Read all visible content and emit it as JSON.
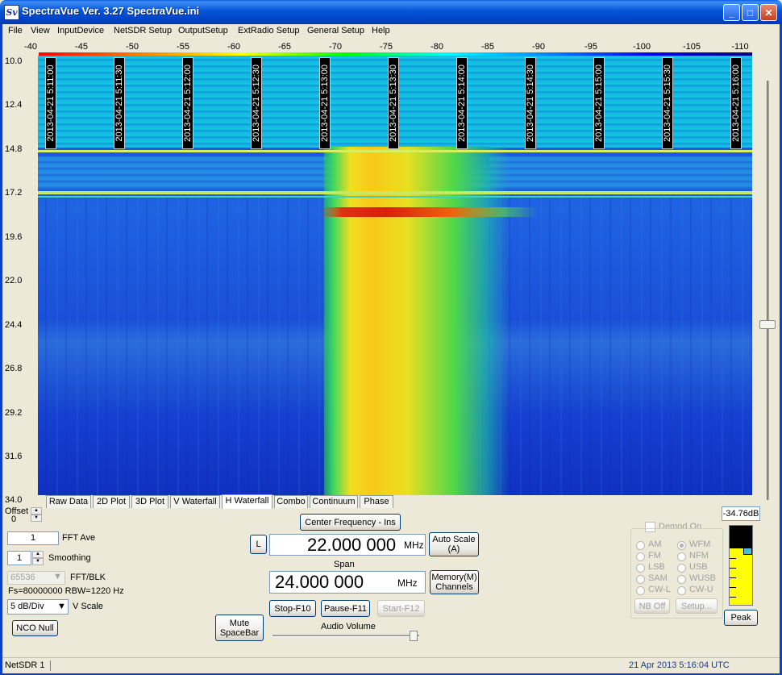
{
  "window": {
    "title": "SpectraVue Ver. 3.27  SpectraVue.ini",
    "icon_label": "Sv"
  },
  "title_buttons": {
    "minimize": "_",
    "maximize": "□",
    "close": "✕"
  },
  "menu": [
    "File",
    "View",
    "InputDevice",
    "NetSDR Setup",
    "OutputSetup",
    "ExtRadio Setup",
    "General Setup",
    "Help"
  ],
  "color_scale_labels": [
    "-40",
    "-45",
    "-50",
    "-55",
    "-60",
    "-65",
    "-70",
    "-75",
    "-80",
    "-85",
    "-90",
    "-95",
    "-100",
    "-105",
    "-110"
  ],
  "frequency_axis_labels": [
    "10.0",
    "12.4",
    "14.8",
    "17.2",
    "19.6",
    "22.0",
    "24.4",
    "26.8",
    "29.2",
    "31.6",
    "34.0"
  ],
  "timestamps": [
    "2013-04-21 5:11:00",
    "2013-04-21 5:11:30",
    "2013-04-21 5:12:00",
    "2013-04-21 5:12:30",
    "2013-04-21 5:13:00",
    "2013-04-21 5:13:30",
    "2013-04-21 5:14:00",
    "2013-04-21 5:14:30",
    "2013-04-21 5:15:00",
    "2013-04-21 5:15:30",
    "2013-04-21 5:16:00"
  ],
  "tabs": [
    "Raw Data",
    "2D Plot",
    "3D Plot",
    "V Waterfall",
    "H Waterfall",
    "Combo",
    "Continuum",
    "Phase"
  ],
  "active_tab": "H Waterfall",
  "controls": {
    "offset_label": "Offset",
    "offset_value": "0",
    "fft_ave_value": "1",
    "fft_ave_label": "FFT Ave",
    "smoothing_value": "1",
    "smoothing_label": "Smoothing",
    "fft_blk_value": "65536",
    "fft_blk_label": "FFT/BLK",
    "fs_info": "Fs=80000000 RBW=1220 Hz",
    "vscale_value": "5 dB/Div",
    "vscale_label": "V Scale",
    "nco_null": "NCO Null",
    "mute_line1": "Mute",
    "mute_line2": "SpaceBar",
    "center_freq_button": "Center Frequency - Ins",
    "l_button": "L",
    "center_freq_value": "22.000 000",
    "center_freq_unit": "MHz",
    "auto_scale_line1": "Auto Scale",
    "auto_scale_line2": "(A)",
    "span_label": "Span",
    "span_value": "24.000 000",
    "span_unit": "MHz",
    "memory_line1": "Memory(M)",
    "memory_line2": "Channels",
    "stop_button": "Stop-F10",
    "pause_button": "Pause-F11",
    "start_button": "Start-F12",
    "audio_volume_label": "Audio Volume"
  },
  "demod": {
    "demod_on_label": "Demod On",
    "modes_left": [
      "AM",
      "FM",
      "LSB",
      "SAM",
      "CW-L"
    ],
    "modes_right": [
      "WFM",
      "NFM",
      "USB",
      "WUSB",
      "CW-U"
    ],
    "selected": "WFM",
    "nb_off": "NB Off",
    "setup": "Setup..."
  },
  "meter": {
    "readout": "-34.76dB",
    "peak_button": "Peak"
  },
  "status": {
    "device": "NetSDR 1",
    "datetime": "21 Apr 2013  5:16:04 UTC"
  }
}
